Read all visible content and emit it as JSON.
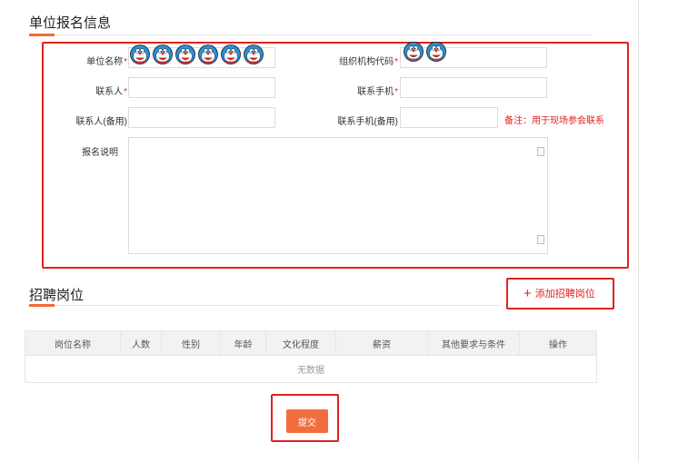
{
  "sections": {
    "unit_info_title": "单位报名信息",
    "positions_title": "招聘岗位"
  },
  "form": {
    "unit_name_label": "单位名称",
    "org_code_label": "组织机构代码",
    "contact_label": "联系人",
    "contact_phone_label": "联系手机",
    "backup_contact_label": "联系人(备用)",
    "backup_phone_label": "联系手机(备用)",
    "description_label": "报名说明",
    "required_mark": "*",
    "note": "备注：用于现场参会联系"
  },
  "positions": {
    "add_button": "添加招聘岗位",
    "columns": [
      "岗位名称",
      "人数",
      "性别",
      "年龄",
      "文化程度",
      "薪资",
      "其他要求与条件",
      "操作"
    ],
    "empty_text": "无数据"
  },
  "actions": {
    "submit": "提交"
  },
  "colors": {
    "accent": "#f06a38",
    "highlight_frame": "#e0221f",
    "submit_bg": "#f26d3d"
  }
}
